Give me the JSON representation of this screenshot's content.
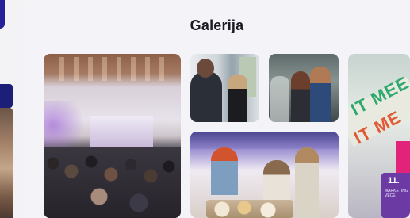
{
  "gallery": {
    "title": "Galerija",
    "photos": [
      {
        "alt": "conference-hall"
      },
      {
        "alt": "speaker"
      },
      {
        "alt": "attendees"
      },
      {
        "alt": "catering-table"
      },
      {
        "alt": "it-meetup-lanyard"
      }
    ]
  },
  "lanyard": {
    "line1": "IT MEE",
    "line2": "IT ME",
    "badge_number": "11.",
    "badge_text": "MARKETING VEČE"
  },
  "colors": {
    "accent_navy": "#26209a",
    "panel_bg": "#f4f4f8",
    "title_text": "#1a1a24"
  }
}
